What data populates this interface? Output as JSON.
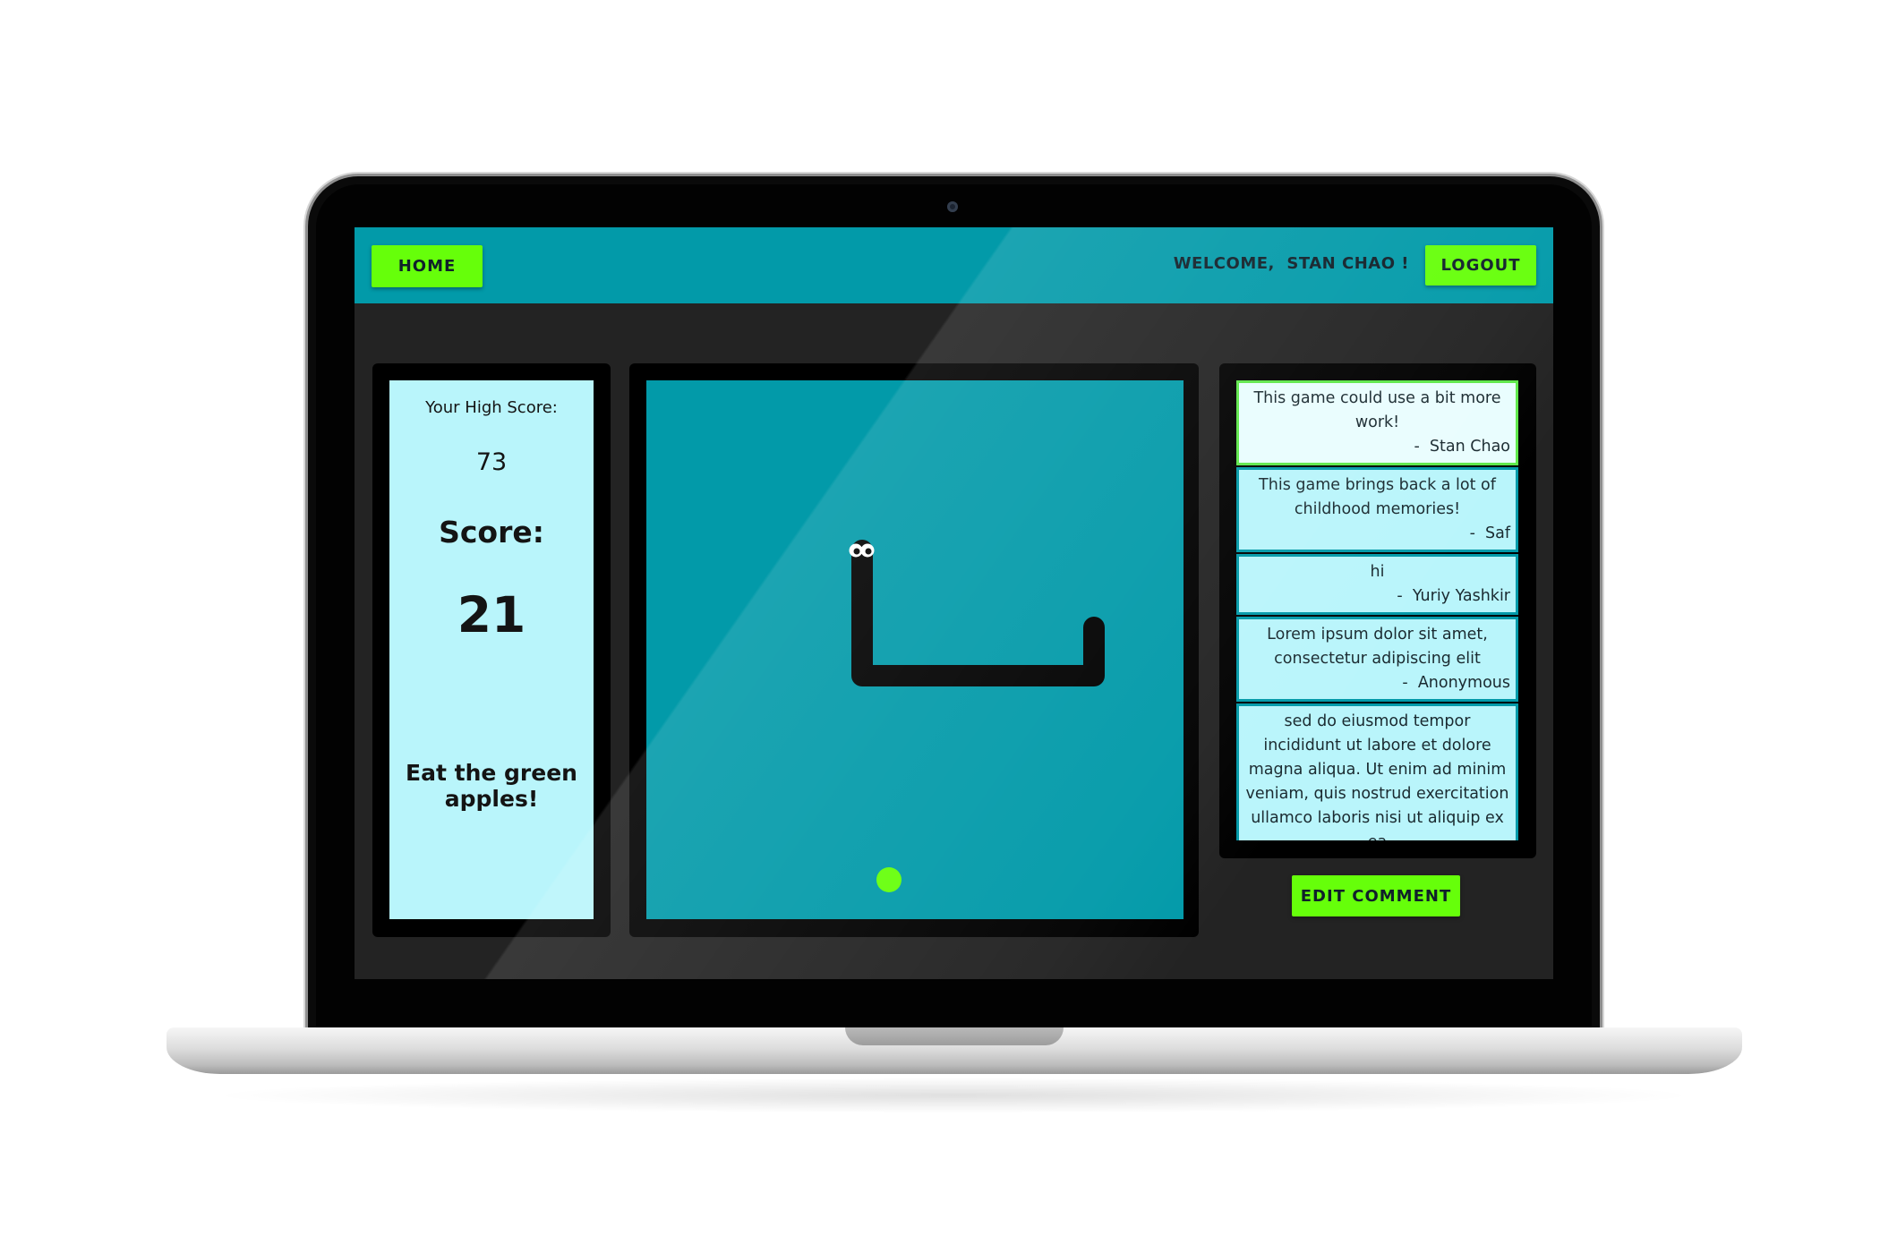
{
  "nav": {
    "home_label": "HOME",
    "welcome_text": "WELCOME,  STAN CHAO !",
    "logout_label": "LOGOUT"
  },
  "score_panel": {
    "high_score_label": "Your High Score:",
    "high_score_value": "73",
    "score_label": "Score:",
    "score_value": "21",
    "hint": "Eat the green apples!"
  },
  "game": {
    "snake_color": "#000000",
    "apple_color": "#66ff0a",
    "board_color": "#029aa9"
  },
  "comments": [
    {
      "text": "This game could use a bit more work!",
      "author": "-  Stan Chao",
      "selected": true
    },
    {
      "text": "This game brings back a lot of childhood memories!",
      "author": "-  Saf",
      "selected": false
    },
    {
      "text": "hi",
      "author": "-  Yuriy Yashkir",
      "selected": false
    },
    {
      "text": "Lorem ipsum dolor sit amet, consectetur adipiscing elit",
      "author": "-  Anonymous",
      "selected": false
    },
    {
      "text": "sed do eiusmod tempor incididunt ut labore et dolore magna aliqua. Ut enim ad minim veniam, quis nostrud exercitation ullamco laboris nisi ut aliquip ex ea",
      "author": "",
      "selected": false
    }
  ],
  "edit_comment_label": "EDIT COMMENT",
  "colors": {
    "accent_green": "#66ff0a",
    "teal": "#029aa9",
    "panel_bg": "#b9f5fb"
  }
}
